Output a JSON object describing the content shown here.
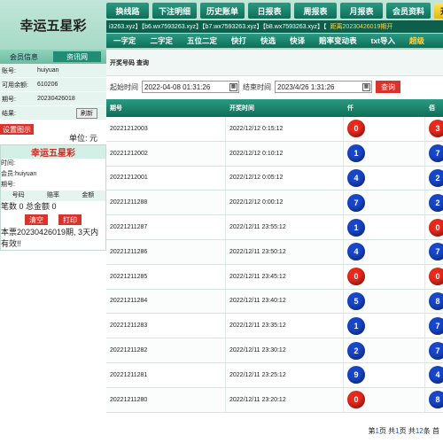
{
  "brand": "幸运五星彩",
  "nav": [
    "换线路",
    "下注明细",
    "历史账单",
    "日报表",
    "周报表",
    "月报表",
    "会员资料",
    "开奖"
  ],
  "domain_strip": {
    "text": "i3263.xyz】【b6.wx7593263.xyz】【b7.wx7593263.xyz】【b8.wx7593263.xyz】【",
    "expire": "距离20230426019期开"
  },
  "sub_nav": [
    "一字定",
    "二字定",
    "五位二定",
    "快打",
    "快选",
    "快译",
    "赔率变动表",
    "txt导入",
    "超级"
  ],
  "left": {
    "tabs": [
      "会员信息",
      "资讯网"
    ],
    "info": [
      {
        "label": "账号:",
        "value": "huiyuan"
      },
      {
        "label": "可用余额:",
        "value": "610206"
      },
      {
        "label": "期号:",
        "value": "20230426018"
      },
      {
        "label": "结果:",
        "value": ""
      }
    ],
    "refresh": "刷新",
    "settings": "设置图示",
    "unit": "单位: 元",
    "box": {
      "title": "幸运五星彩",
      "time_label": "时间:",
      "member_label": "会员:huiyuan",
      "issue_label": "期号:",
      "head": [
        "号码",
        "赔率",
        "金额"
      ],
      "totals": "笔数 0 总金额 0",
      "clear": "清空",
      "print": "打印",
      "notice": "本票20230426019期, 3天内有效!!"
    }
  },
  "main": {
    "title": "开奖号码 查询",
    "start_label": "起始时间",
    "start_value": "2022-04-08 01:31:26",
    "end_label": "结束时间",
    "end_value": "2023/4/26 1:31:26",
    "query": "查询",
    "columns": [
      "期号",
      "开奖时间",
      "仟",
      "佰"
    ],
    "rows": [
      {
        "issue": "20221212003",
        "time": "2022/12/12 0:15:12",
        "q": "0",
        "b": "3"
      },
      {
        "issue": "20221212002",
        "time": "2022/12/12 0:10:12",
        "q": "1",
        "b": "7"
      },
      {
        "issue": "20221212001",
        "time": "2022/12/12 0:05:12",
        "q": "4",
        "b": "2"
      },
      {
        "issue": "20221211288",
        "time": "2022/12/12 0:00:12",
        "q": "7",
        "b": "2"
      },
      {
        "issue": "20221211287",
        "time": "2022/12/11 23:55:12",
        "q": "1",
        "b": "0"
      },
      {
        "issue": "20221211286",
        "time": "2022/12/11 23:50:12",
        "q": "4",
        "b": "7"
      },
      {
        "issue": "20221211285",
        "time": "2022/12/11 23:45:12",
        "q": "0",
        "b": "0"
      },
      {
        "issue": "20221211284",
        "time": "2022/12/11 23:40:12",
        "q": "5",
        "b": "8"
      },
      {
        "issue": "20221211283",
        "time": "2022/12/11 23:35:12",
        "q": "1",
        "b": "7"
      },
      {
        "issue": "20221211282",
        "time": "2022/12/11 23:30:12",
        "q": "2",
        "b": "7"
      },
      {
        "issue": "20221211281",
        "time": "2022/12/11 23:25:12",
        "q": "9",
        "b": "4"
      },
      {
        "issue": "20221211280",
        "time": "2022/12/11 23:20:12",
        "q": "0",
        "b": "8"
      }
    ],
    "pager": {
      "pre": "第",
      "page": "1",
      "mid": "页 共",
      "total_pages": "1",
      "mid2": "页 共",
      "count": "12",
      "post": "条 首"
    }
  },
  "colors": {
    "red_ball": "#e8291c",
    "blue_ball": "#1746c9",
    "accent": "#0e6e58",
    "brand_red": "#c82a22"
  }
}
